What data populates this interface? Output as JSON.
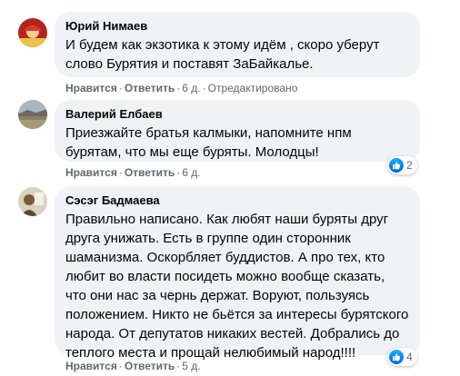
{
  "colors": {
    "bubble": "#f0f2f5",
    "meta": "#65676b",
    "like": "#1877f2"
  },
  "top_fragment": "· · · · · · · · · · · · · · · · · · · · · · ·",
  "comments": [
    {
      "author": "Юрий Нимаев",
      "text": "И будем как экзотика к этому идём , скоро уберут слово Бурятия и поставят ЗаБайкалье.",
      "like_label": "Нравится",
      "reply_label": "Ответить",
      "time": "6 д.",
      "edited": "Отредактировано",
      "avatar_icon": "user-avatar-icon"
    },
    {
      "author": "Валерий Елбаев",
      "text": "Приезжайте братья калмыки, напомните нпм бурятам, что мы еще буряты. Молодцы!",
      "like_label": "Нравится",
      "reply_label": "Ответить",
      "time": "6 д.",
      "reactions": "2",
      "avatar_icon": "landscape-avatar-icon"
    },
    {
      "author": "Сэсэг Бадмаева",
      "text": "Правильно написано. Как любят наши буряты друг друга унижать. Есть в группе один сторонник шаманизма. Оскорбляет буддистов. А про тех, кто любит во власти посидеть можно вообще сказать, что они нас за чернь держат. Воруют, пользуясь положением. Никто не бьётся за интересы бурятского народа. От депутатов никаких вестей. Добрались до теплого места и прощай нелюбимый народ!!!!",
      "like_label": "Нравится",
      "reply_label": "Ответить",
      "time": "5 д.",
      "reactions": "4",
      "avatar_icon": "user-avatar-icon"
    }
  ]
}
